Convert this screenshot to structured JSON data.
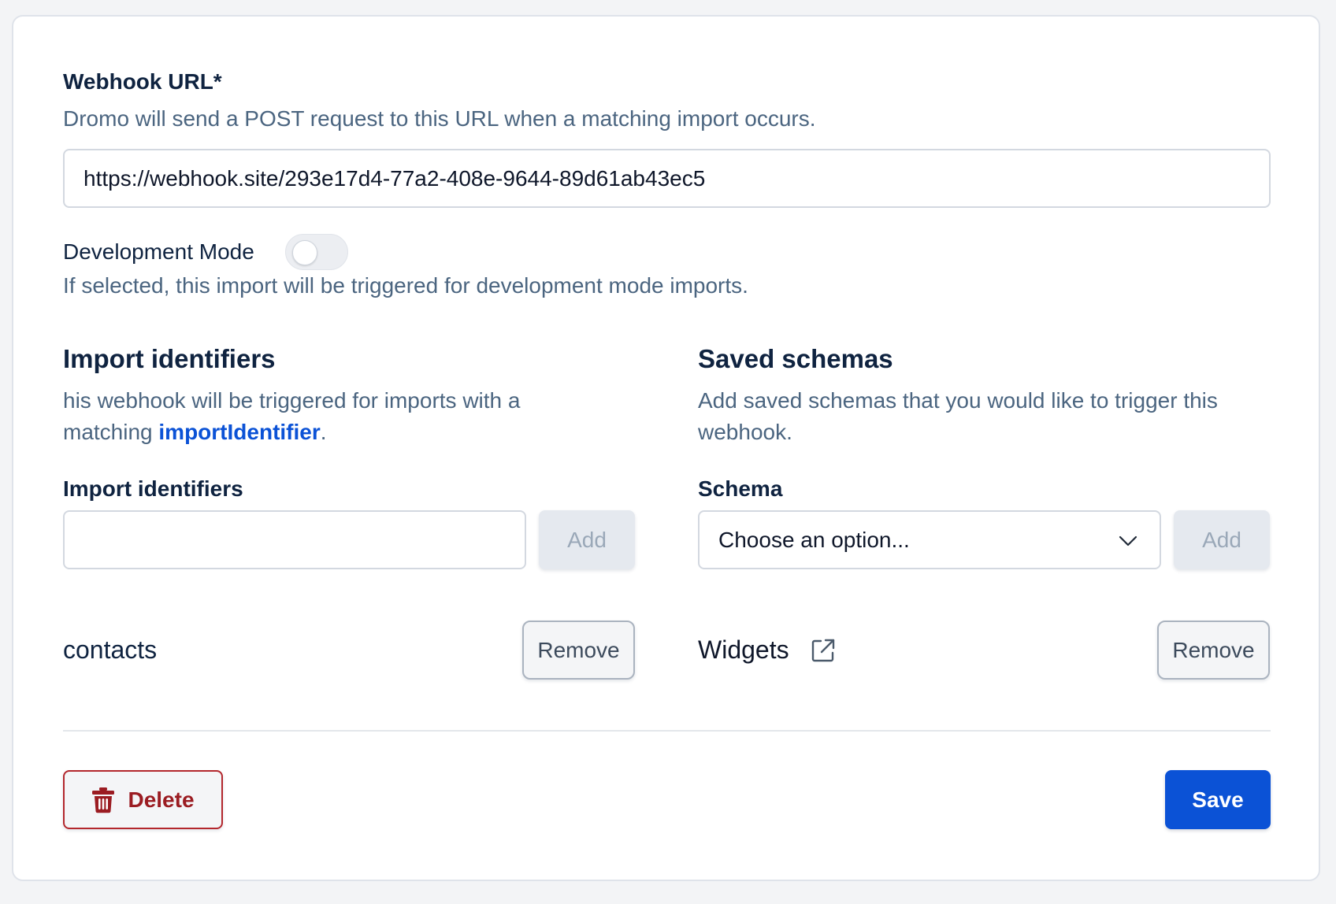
{
  "webhook_url": {
    "label": "Webhook URL*",
    "help": "Dromo will send a POST request to this URL when a matching import occurs.",
    "value": "https://webhook.site/293e17d4-77a2-408e-9644-89d61ab43ec5"
  },
  "development_mode": {
    "label": "Development Mode",
    "enabled": false,
    "help": "If selected, this import will be triggered for development mode imports."
  },
  "import_identifiers": {
    "title": "Import identifiers",
    "help_prefix": "his webhook will be triggered for imports with a matching ",
    "help_link": "importIdentifier",
    "help_suffix": ".",
    "field_label": "Import identifiers",
    "input_value": "",
    "add_label": "Add",
    "items": [
      {
        "name": "contacts",
        "remove_label": "Remove"
      }
    ]
  },
  "saved_schemas": {
    "title": "Saved schemas",
    "help": "Add saved schemas that you would like to trigger this webhook.",
    "field_label": "Schema",
    "select_placeholder": "Choose an option...",
    "add_label": "Add",
    "items": [
      {
        "name": "Widgets",
        "remove_label": "Remove"
      }
    ]
  },
  "footer": {
    "delete_label": "Delete",
    "save_label": "Save"
  },
  "colors": {
    "primary": "#0b52d6",
    "danger": "#9b1c22",
    "heading": "#0f2340",
    "muted": "#4b6580"
  }
}
